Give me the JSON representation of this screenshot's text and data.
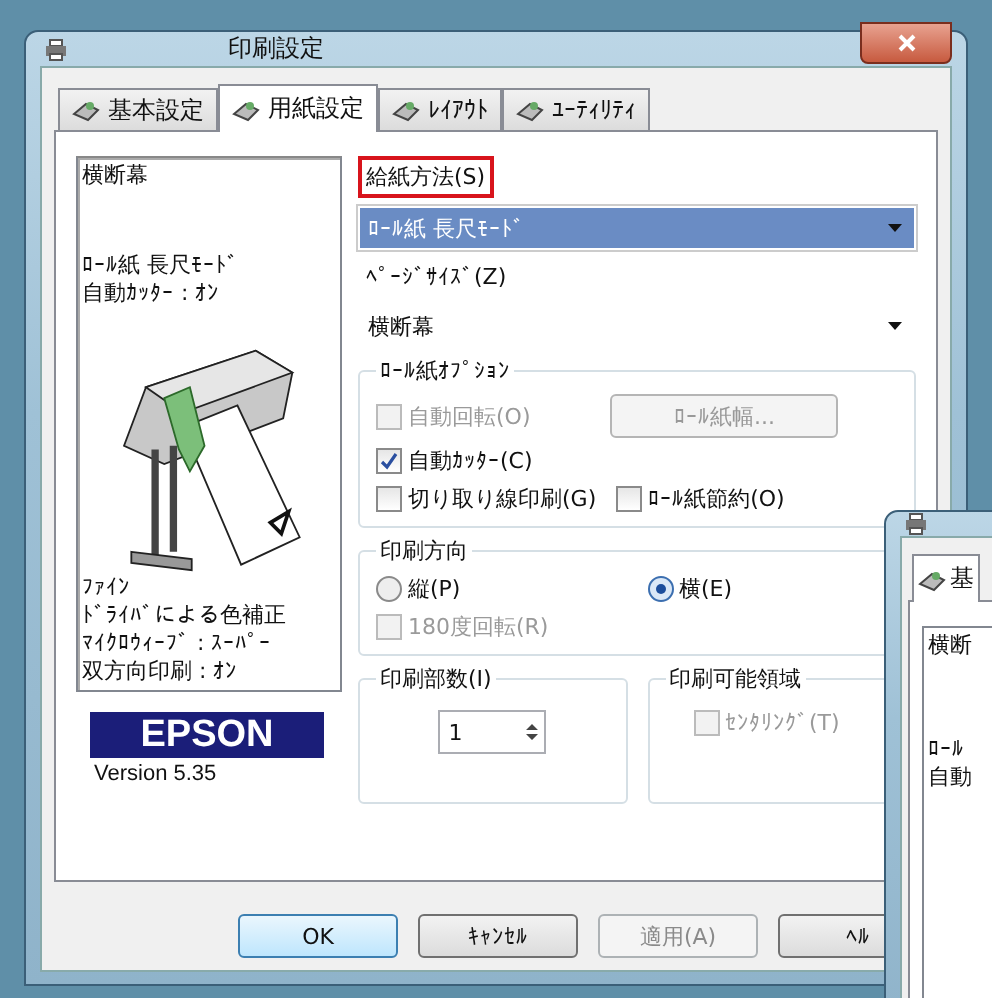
{
  "window": {
    "title": "印刷設定"
  },
  "tabs": [
    {
      "label": "基本設定",
      "selected": false
    },
    {
      "label": "用紙設定",
      "selected": true
    },
    {
      "label": "ﾚｲｱｳﾄ",
      "selected": false
    },
    {
      "label": "ﾕｰﾃｨﾘﾃｨ",
      "selected": false
    }
  ],
  "summary": {
    "title": "横断幕",
    "media_lines": [
      "ﾛｰﾙ紙 長尺ﾓｰﾄﾞ",
      "自動ｶｯﾀｰ : ｵﾝ"
    ],
    "quality_lines": [
      "ﾌｧｲﾝ",
      "ﾄﾞﾗｲﾊﾞによる色補正",
      "ﾏｲｸﾛｳｨｰﾌﾞ : ｽｰﾊﾟｰ",
      "双方向印刷 : ｵﾝ"
    ]
  },
  "logo": "EPSON",
  "version": "Version 5.35",
  "paper_source": {
    "label": "給紙方法(S)",
    "highlighted": true,
    "value": "ﾛｰﾙ紙 長尺ﾓｰﾄﾞ"
  },
  "page_size": {
    "label": "ﾍﾟｰｼﾞｻｲｽﾞ(Z)",
    "value": "横断幕"
  },
  "roll_options": {
    "title": "ﾛｰﾙ紙ｵﾌﾟｼｮﾝ",
    "width_button": {
      "label": "ﾛｰﾙ紙幅...",
      "disabled": true
    },
    "checkboxes": [
      {
        "label": "自動回転(O)",
        "checked": false,
        "disabled": true
      },
      {
        "label": "自動ｶｯﾀｰ(C)",
        "checked": true,
        "disabled": false
      },
      {
        "label": "切り取り線印刷(G)",
        "checked": false,
        "disabled": false
      },
      {
        "label": "ﾛｰﾙ紙節約(O)",
        "checked": false,
        "disabled": false
      }
    ]
  },
  "orientation": {
    "title": "印刷方向",
    "radios": [
      {
        "label": "縦(P)",
        "selected": false
      },
      {
        "label": "横(E)",
        "selected": true
      }
    ],
    "rotate": {
      "label": "180度回転(R)",
      "checked": false,
      "disabled": true
    }
  },
  "copies": {
    "title": "印刷部数(I)",
    "value": "1"
  },
  "printable_area": {
    "title": "印刷可能領域",
    "centering": {
      "label": "ｾﾝﾀﾘﾝｸﾞ(T)",
      "checked": false,
      "disabled": true
    }
  },
  "buttons": [
    {
      "label": "OK",
      "disabled": false,
      "default": true
    },
    {
      "label": "ｷｬﾝｾﾙ",
      "disabled": false,
      "default": false
    },
    {
      "label": "適用(A)",
      "disabled": true,
      "default": false
    },
    {
      "label": "ﾍﾙ",
      "disabled": false,
      "default": false
    }
  ],
  "second_window": {
    "tab": "基",
    "preview_lines": [
      "横断",
      "ﾛｰﾙ",
      "自動"
    ]
  }
}
